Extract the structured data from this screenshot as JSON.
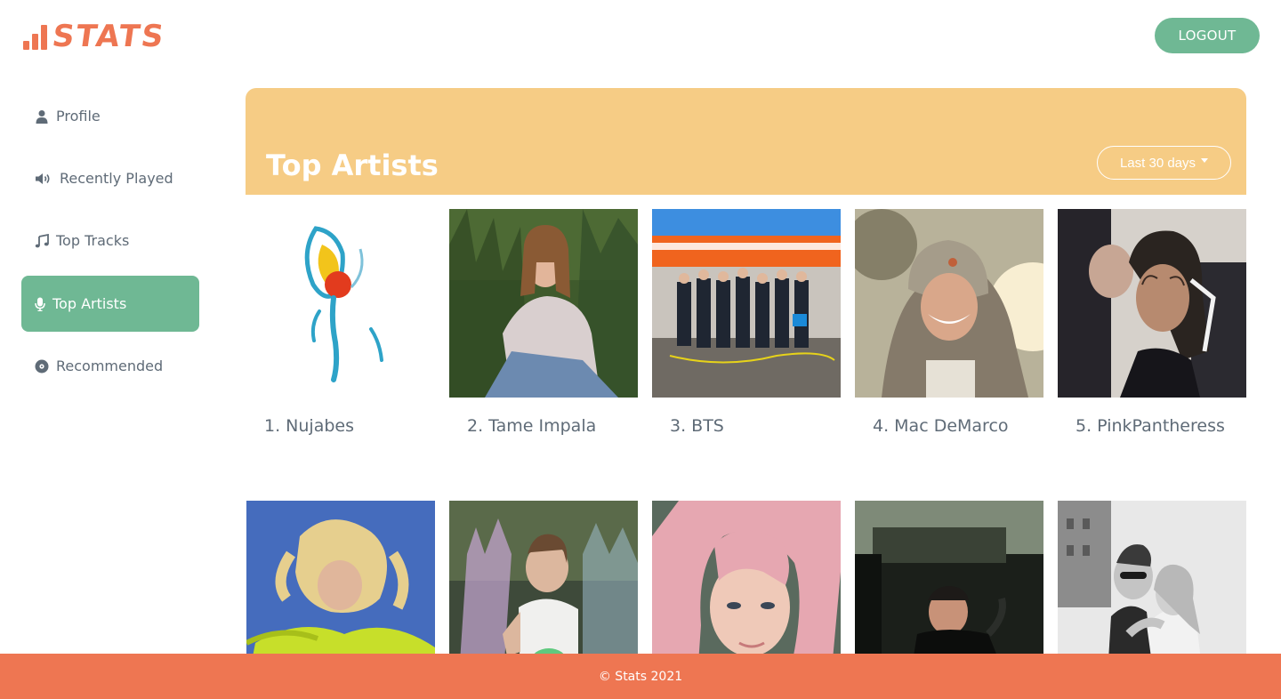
{
  "app": {
    "logo_text": "STATS"
  },
  "header": {
    "logout_label": "LOGOUT"
  },
  "sidebar": {
    "items": [
      {
        "label": "Profile",
        "icon": "user-icon",
        "active": false
      },
      {
        "label": "Recently Played",
        "icon": "speaker-icon",
        "active": false
      },
      {
        "label": "Top Tracks",
        "icon": "music-note-icon",
        "active": false
      },
      {
        "label": "Top Artists",
        "icon": "microphone-icon",
        "active": true
      },
      {
        "label": "Recommended",
        "icon": "disc-icon",
        "active": false
      }
    ]
  },
  "main": {
    "title": "Top Artists",
    "range_selected": "Last 30 days",
    "artists": [
      {
        "name": "1. Nujabes"
      },
      {
        "name": "2. Tame Impala"
      },
      {
        "name": "3. BTS"
      },
      {
        "name": "4. Mac DeMarco"
      },
      {
        "name": "5. PinkPantheress"
      }
    ]
  },
  "footer": {
    "text": "© Stats 2021"
  },
  "colors": {
    "brand_orange": "#ee7652",
    "accent_green": "#6fb894",
    "banner_yellow": "#f6cc85",
    "text_gray": "#5f6b77"
  }
}
